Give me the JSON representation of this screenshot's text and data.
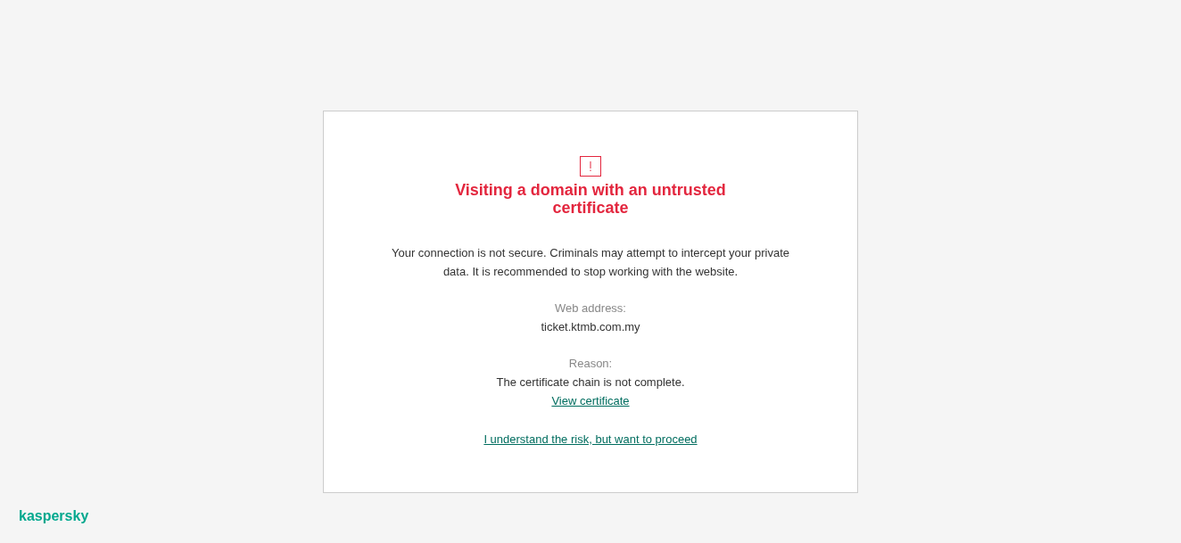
{
  "alert": {
    "title": "Visiting a domain with an untrusted certificate",
    "message": "Your connection is not secure. Criminals may attempt to intercept your private data. It is recommended to stop working with the website.",
    "details": [
      {
        "label": "Web address:",
        "value": "ticket.ktmb.com.my"
      },
      {
        "label": "Reason:",
        "value": "The certificate chain is not complete.",
        "link": "View certificate"
      }
    ],
    "proceed_link": "I understand the risk, but want to proceed"
  },
  "brand": {
    "logo": "kaspersky"
  }
}
